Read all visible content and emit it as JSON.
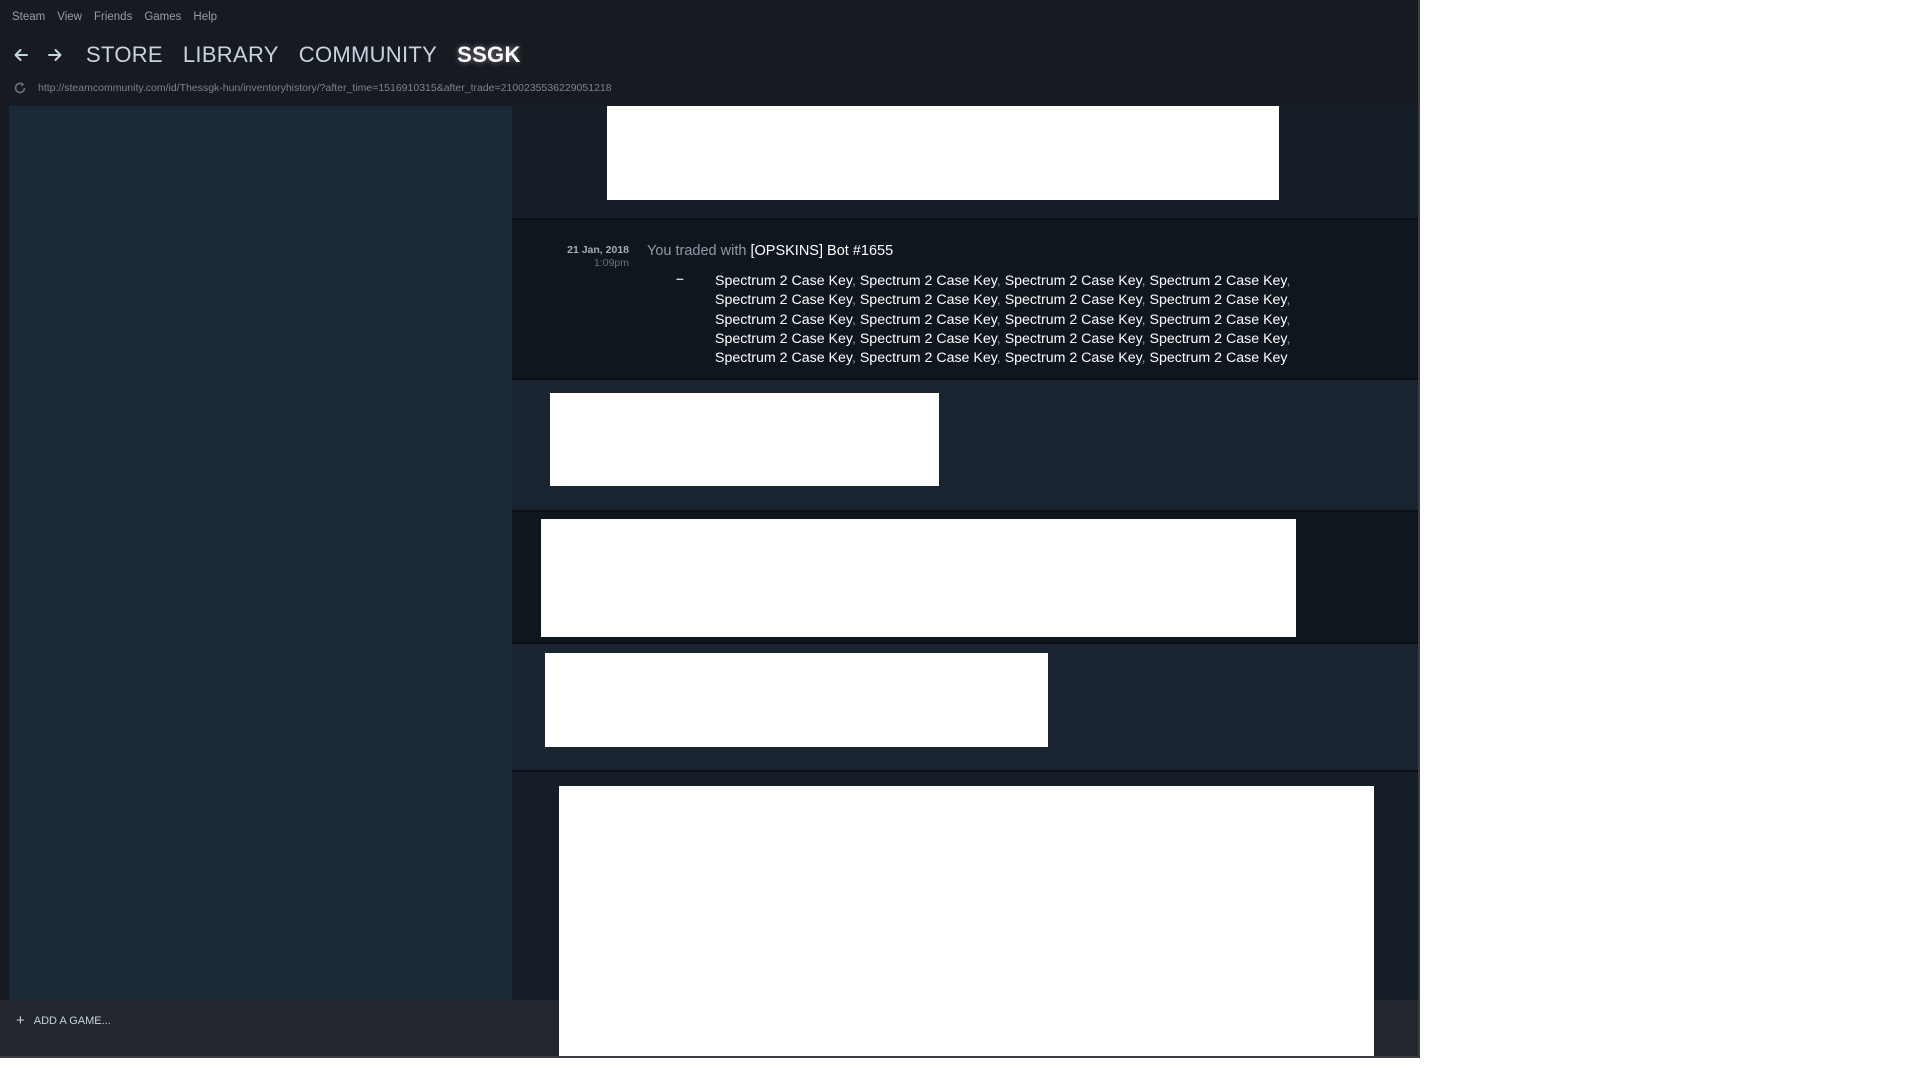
{
  "menu": {
    "items": [
      "Steam",
      "View",
      "Friends",
      "Games",
      "Help"
    ]
  },
  "nav": {
    "back_icon": "arrow-left-icon",
    "forward_icon": "arrow-right-icon",
    "links": [
      {
        "label": "STORE",
        "active": false
      },
      {
        "label": "LIBRARY",
        "active": false
      },
      {
        "label": "COMMUNITY",
        "active": false
      },
      {
        "label": "SSGK",
        "active": true
      }
    ]
  },
  "address": {
    "refresh_icon": "refresh-icon",
    "url": "http://steamcommunity.com/id/Thessgk-hun/inventoryhistory/?after_time=1516910315&after_trade=2100235536229051218"
  },
  "trade": {
    "date": "21 Jan, 2018",
    "time": "1:09pm",
    "prefix": "You traded with",
    "partner": "[OPSKINS] Bot #1655",
    "sign": "–",
    "item_name": "Spectrum 2 Case Key",
    "item_count": 20,
    "items_per_line": 4
  },
  "bottom": {
    "add_game_label": "ADD A GAME...",
    "plus_icon": "plus-icon"
  },
  "colors": {
    "window_bg": "#171a21",
    "left_panel_bg": "#1b2838",
    "nav_text": "#c6d4df",
    "active_nav": "#ffffff",
    "redaction": "#ffffff"
  }
}
